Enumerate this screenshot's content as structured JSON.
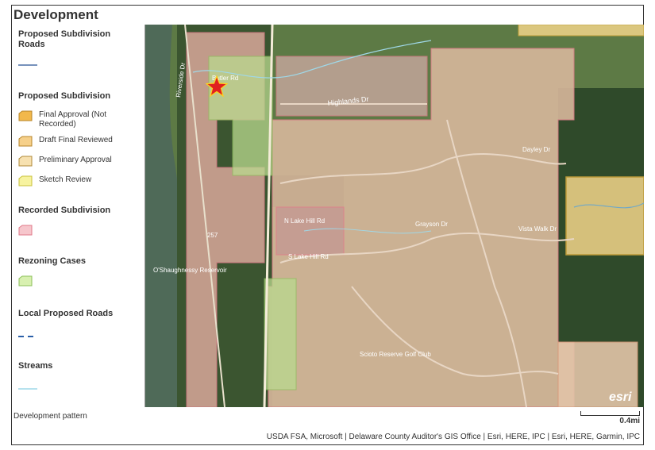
{
  "title": "Development",
  "legend": {
    "proposed_roads": {
      "heading": "Proposed Subdivision Roads",
      "color": "#4a6fa5"
    },
    "proposed_subdivision": {
      "heading": "Proposed Subdivision",
      "items": [
        {
          "label": "Final Approval (Not Recorded)",
          "fill": "#f2b84b",
          "stroke": "#b8862a"
        },
        {
          "label": "Draft Final Reviewed",
          "fill": "#f6d08a",
          "stroke": "#b8862a"
        },
        {
          "label": "Preliminary Approval",
          "fill": "#f7e1b0",
          "stroke": "#b08a3a"
        },
        {
          "label": "Sketch Review",
          "fill": "#f7f3a0",
          "stroke": "#c9c23a"
        }
      ]
    },
    "recorded_subdivision": {
      "heading": "Recorded Subdivision",
      "fill": "#f6c6cc",
      "stroke": "#e07a8a"
    },
    "rezoning": {
      "heading": "Rezoning Cases",
      "fill": "#d8f0b0",
      "stroke": "#8cc05a"
    },
    "local_roads": {
      "heading": "Local Proposed Roads",
      "color": "#2a5fa8"
    },
    "streams": {
      "heading": "Streams",
      "color": "#9fd8e8"
    }
  },
  "map": {
    "labels": {
      "riverside": "Riverside Dr",
      "butler": "Butler Rd",
      "highlands": "Highlands Dr",
      "reservoir": "O'Shaughnessy Reservoir",
      "lake_hill": "N Lake Hill Rd",
      "s_lake_hill": "S Lake Hill Rd",
      "grayson": "Grayson Dr",
      "vista_walk": "Vista Walk Dr",
      "dayley": "Dayley Dr",
      "golf": "Scioto Reserve Golf Club",
      "route": "257",
      "esri": "esri"
    },
    "colors": {
      "water": "#4f6f5c",
      "forest": "#2f4a2a",
      "field": "#6f8a4e",
      "recorded": "#e8b9a8",
      "proposed": "#f2d58a",
      "rezoning": "#cfe6a0"
    }
  },
  "caption": "Development pattern",
  "scale_label": "0.4mi",
  "attribution": "USDA FSA, Microsoft | Delaware County Auditor's GIS Office | Esri, HERE, IPC | Esri, HERE, Garmin, IPC"
}
